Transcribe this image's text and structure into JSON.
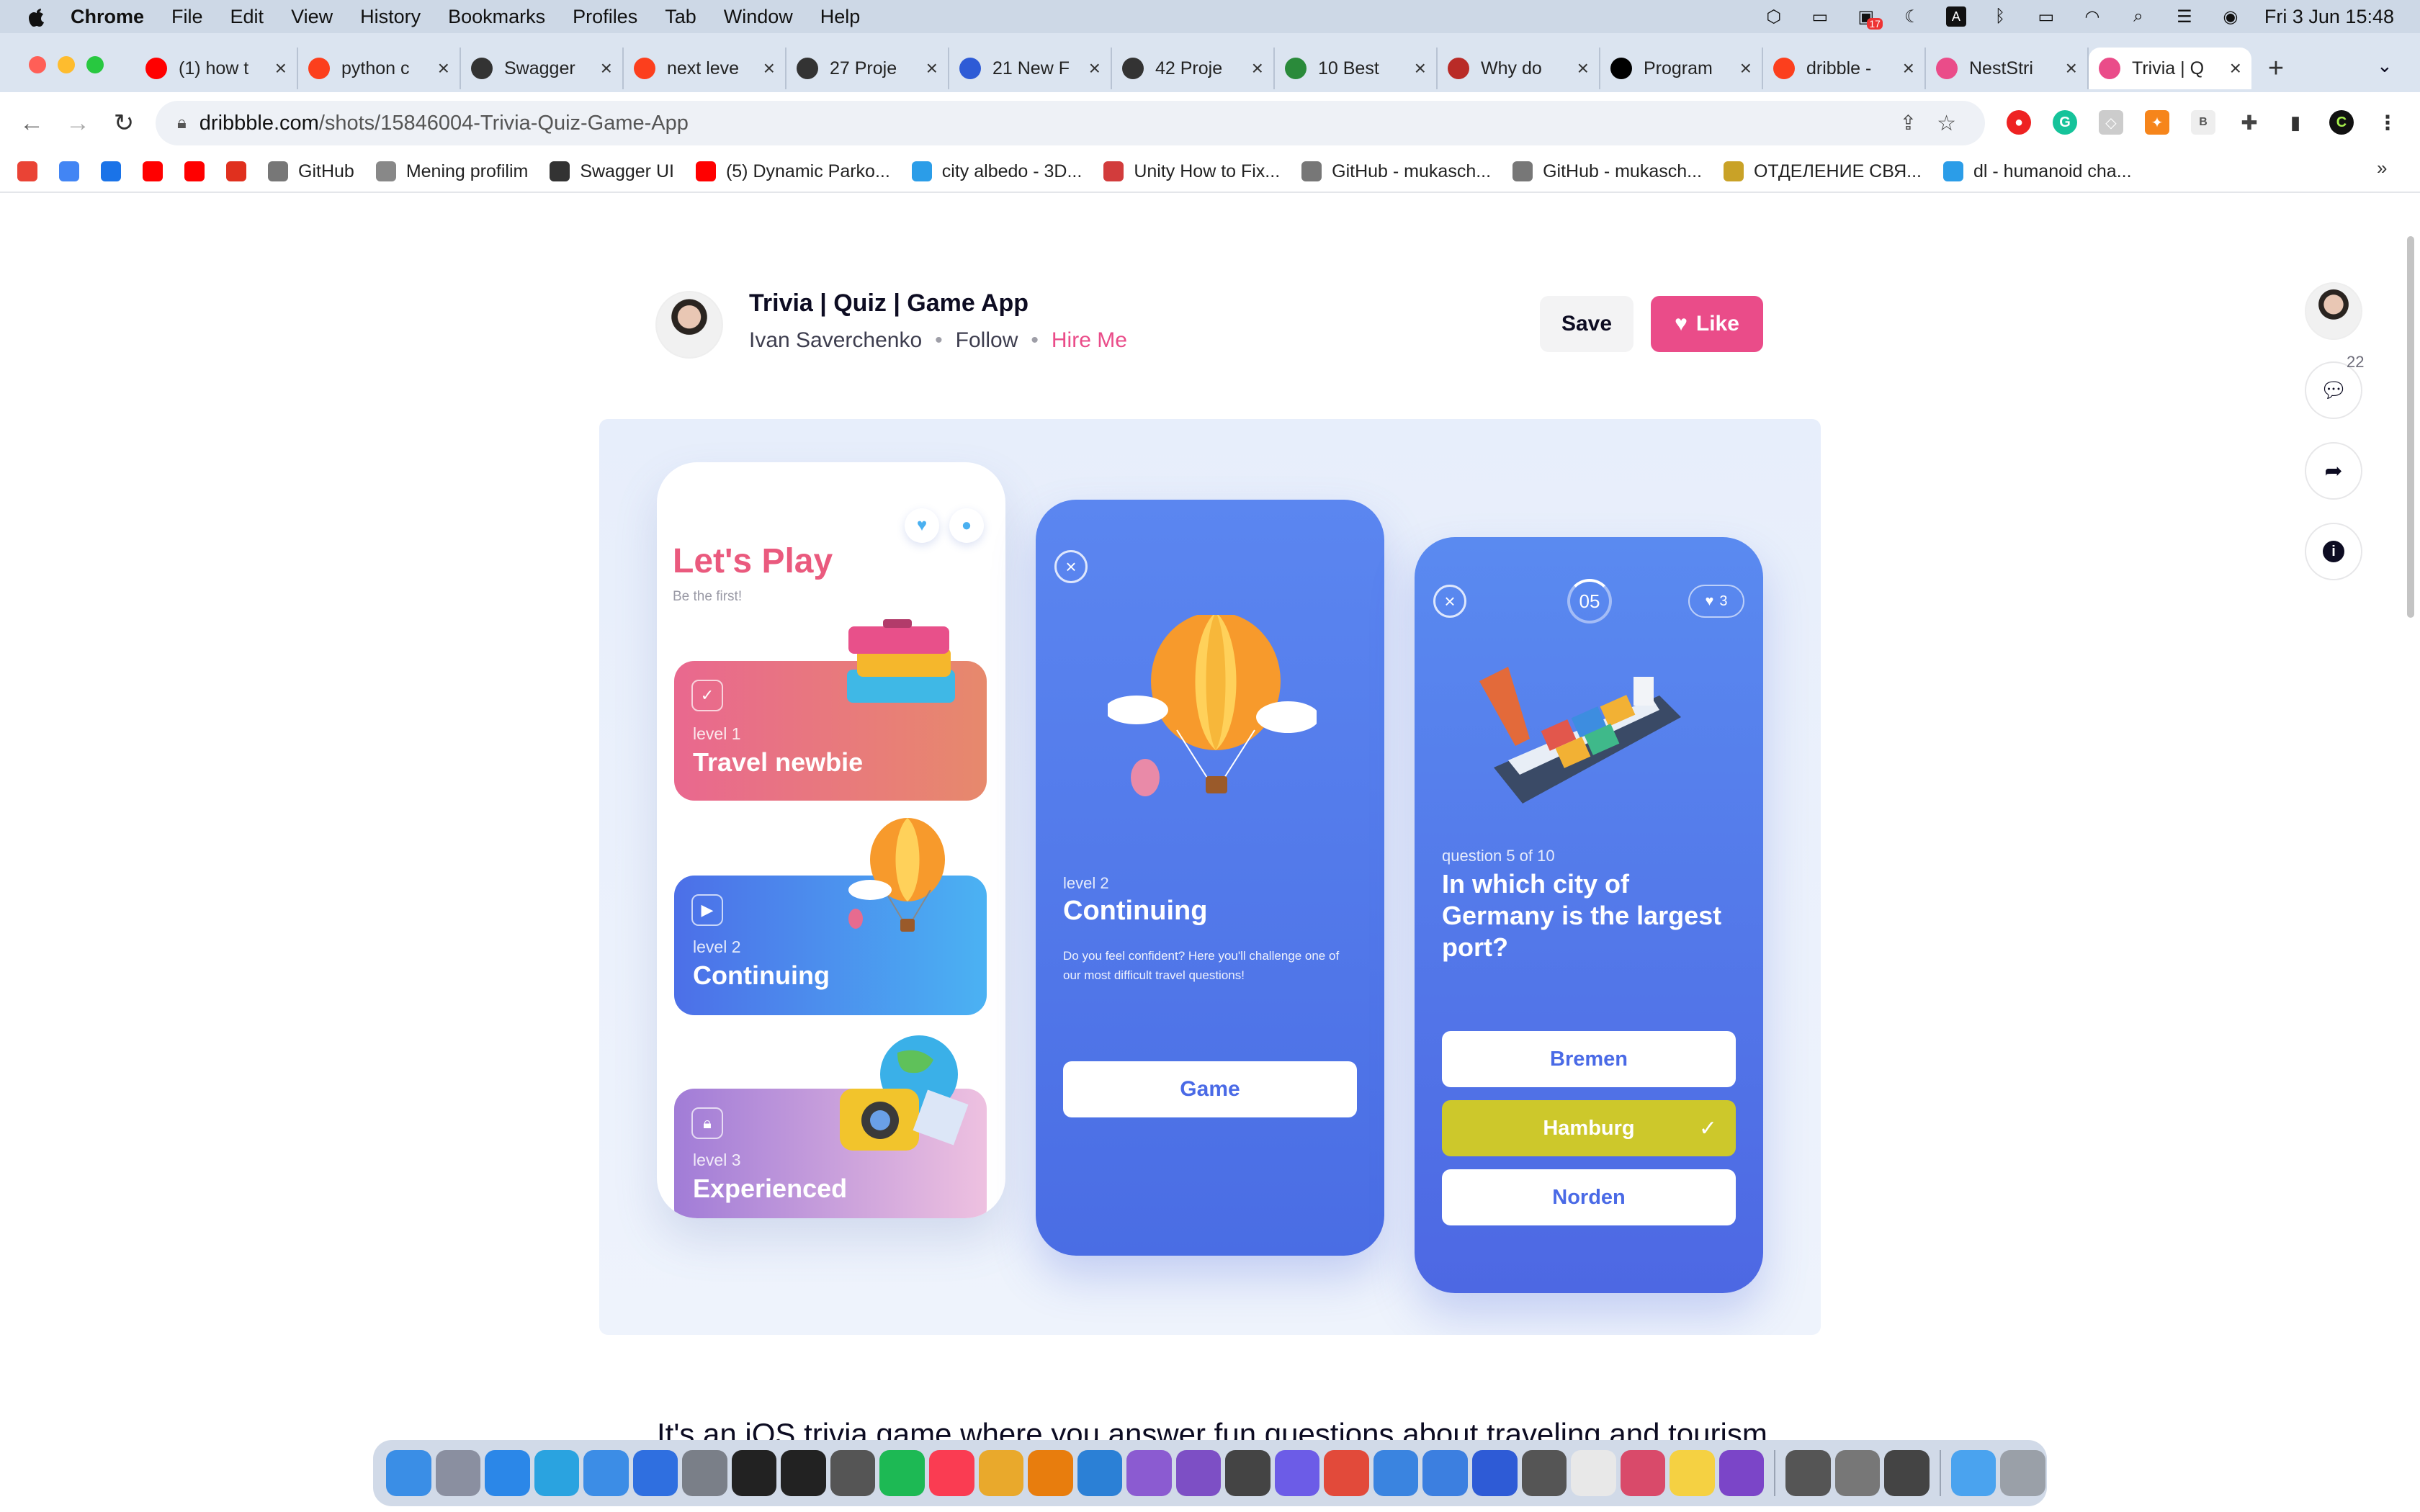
{
  "menubar": {
    "apple": "",
    "app": "Chrome",
    "items": [
      "File",
      "Edit",
      "View",
      "History",
      "Bookmarks",
      "Profiles",
      "Tab",
      "Window",
      "Help"
    ],
    "datetime": "Fri 3 Jun  15:48",
    "badge_count": "17"
  },
  "tabs": [
    {
      "title": "(1) how t",
      "icon": "youtube-icon",
      "color": "#ff0000"
    },
    {
      "title": "python c",
      "icon": "yandex-icon",
      "color": "#fc3f1d"
    },
    {
      "title": "Swagger",
      "icon": "globe-icon",
      "color": "#333333"
    },
    {
      "title": "next leve",
      "icon": "yandex-icon",
      "color": "#fc3f1d"
    },
    {
      "title": "27 Proje",
      "icon": "globe-icon",
      "color": "#333333"
    },
    {
      "title": "21 New F",
      "icon": "f-icon",
      "color": "#2e5bd6"
    },
    {
      "title": "42 Proje",
      "icon": "x-circle-icon",
      "color": "#333333"
    },
    {
      "title": "10 Best",
      "icon": "glasses-icon",
      "color": "#2a8a3a"
    },
    {
      "title": "Why do",
      "icon": "quora-icon",
      "color": "#b92b27"
    },
    {
      "title": "Program",
      "icon": "dev-icon",
      "color": "#000000"
    },
    {
      "title": "dribble -",
      "icon": "yandex-icon",
      "color": "#fc3f1d"
    },
    {
      "title": "NestStri",
      "icon": "dribbble-icon",
      "color": "#ea4c89"
    },
    {
      "title": "Trivia | Q",
      "icon": "dribbble-icon",
      "color": "#ea4c89"
    }
  ],
  "address": {
    "host": "dribbble.com",
    "path": "/shots/15846004-Trivia-Quiz-Game-App"
  },
  "bookmarks": [
    {
      "label": "",
      "icon": "gmail-icon",
      "color": "#ea4335"
    },
    {
      "label": "",
      "icon": "translate-icon",
      "color": "#4285f4"
    },
    {
      "label": "",
      "icon": "b-icon",
      "color": "#1a73e8"
    },
    {
      "label": "",
      "icon": "youtube-icon",
      "color": "#ff0000"
    },
    {
      "label": "",
      "icon": "youtube-icon",
      "color": "#ff0000"
    },
    {
      "label": "",
      "icon": "arrow-icon",
      "color": "#e0301e"
    },
    {
      "label": "GitHub",
      "icon": "github-icon",
      "color": "#777777"
    },
    {
      "label": "Mening profilim",
      "icon": "profile-icon",
      "color": "#888888"
    },
    {
      "label": "Swagger UI",
      "icon": "globe-icon",
      "color": "#333333"
    },
    {
      "label": "(5) Dynamic Parko...",
      "icon": "youtube-icon",
      "color": "#ff0000"
    },
    {
      "label": "city albedo - 3D...",
      "icon": "cube-icon",
      "color": "#2b9de8"
    },
    {
      "label": "Unity How to Fix...",
      "icon": "pin-icon",
      "color": "#d23c3c"
    },
    {
      "label": "GitHub - mukasch...",
      "icon": "github-icon",
      "color": "#777777"
    },
    {
      "label": "GitHub - mukasch...",
      "icon": "github-icon",
      "color": "#777777"
    },
    {
      "label": "ОТДЕЛЕНИЕ СВЯ...",
      "icon": "building-icon",
      "color": "#c9a227"
    },
    {
      "label": "dl - humanoid cha...",
      "icon": "cube-icon",
      "color": "#2b9de8"
    }
  ],
  "shot": {
    "title": "Trivia | Quiz | Game App",
    "author": "Ivan Saverchenko",
    "follow": "Follow",
    "hire": "Hire Me",
    "save": "Save",
    "like": "Like",
    "comments": "22",
    "description": "It's an iOS trivia game where you answer fun questions about traveling and tourism."
  },
  "app": {
    "screen1": {
      "title": "Let's Play",
      "subtitle": "Be the first!",
      "levels": [
        {
          "level": "level 1",
          "name": "Travel newbie",
          "icon": "check-icon"
        },
        {
          "level": "level 2",
          "name": "Continuing",
          "icon": "play-icon"
        },
        {
          "level": "level 3",
          "name": "Experienced",
          "icon": "lock-icon"
        }
      ]
    },
    "screen2": {
      "level": "level 2",
      "name": "Continuing",
      "description": "Do you feel confident? Here you'll challenge one of our most difficult travel questions!",
      "button": "Game"
    },
    "screen3": {
      "timer": "05",
      "lives": "3",
      "counter": "question 5 of 10",
      "question": "In which city of Germany is the largest port?",
      "answers": [
        "Bremen",
        "Hamburg",
        "Norden"
      ],
      "selected": "Hamburg"
    }
  },
  "colors": {
    "brand_pink": "#ea4c89",
    "app_blue": "#4d6ee6",
    "selected_answer": "#cdc82b"
  }
}
